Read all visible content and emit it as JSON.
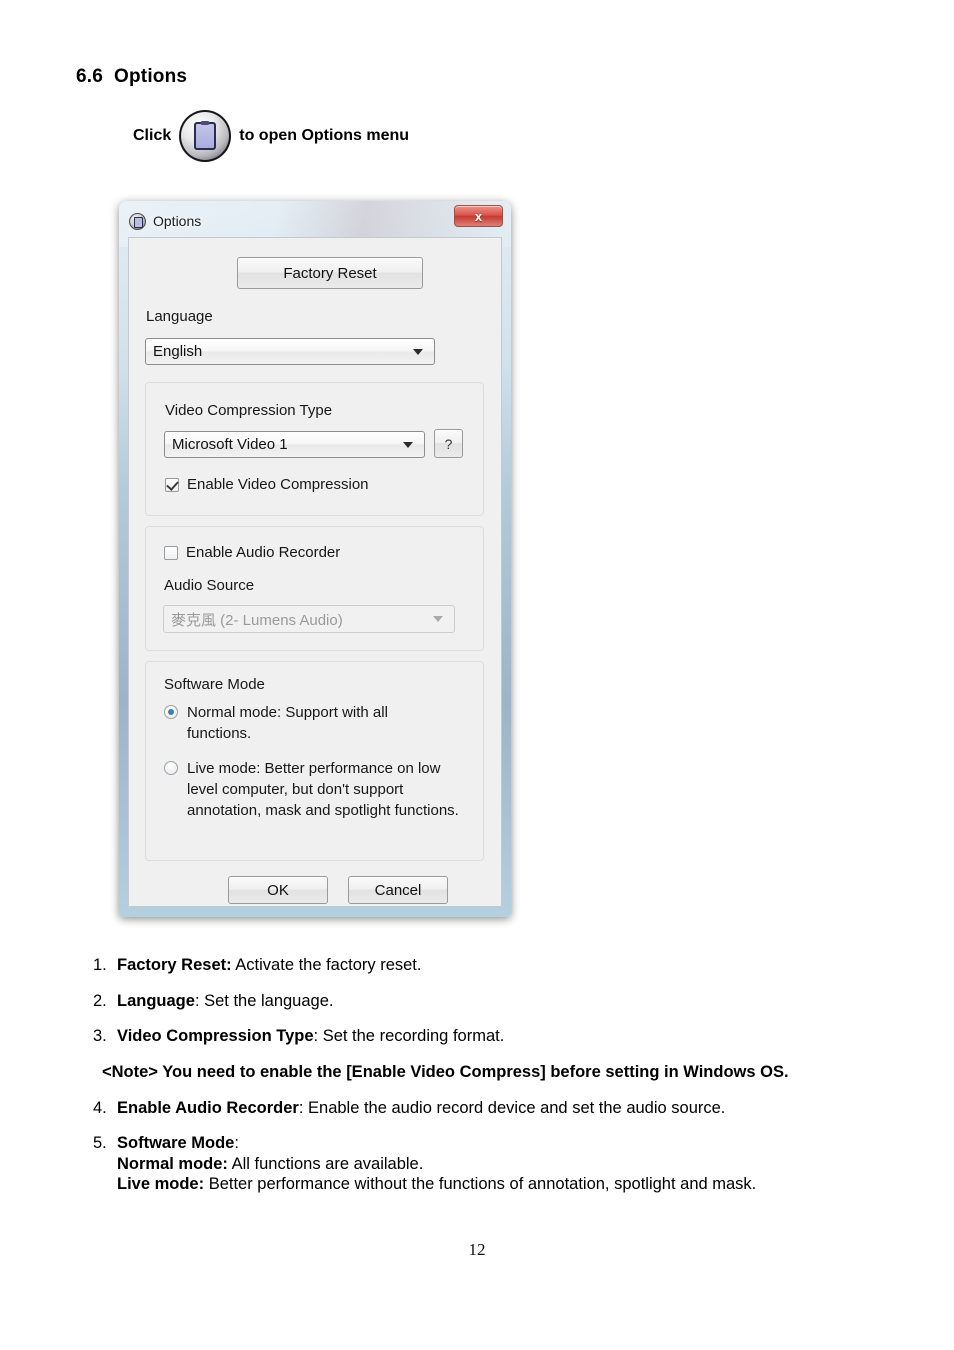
{
  "document": {
    "section_number": "6.6",
    "section_title": "Options",
    "click_prefix": "Click",
    "click_suffix": "to open Options menu",
    "page_number": "12"
  },
  "dialog": {
    "title": "Options",
    "title_icon": "options-window-icon",
    "close_label": "x",
    "factory_reset_label": "Factory Reset",
    "language_label": "Language",
    "language_value": "English",
    "video_group": {
      "type_label": "Video Compression Type",
      "type_value": "Microsoft Video 1",
      "help_label": "?",
      "enable_label": "Enable Video Compression",
      "enable_checked": true
    },
    "audio_group": {
      "enable_label": "Enable Audio Recorder",
      "enable_checked": false,
      "source_label": "Audio Source",
      "source_value": "麥克風 (2- Lumens Audio)",
      "source_disabled": true
    },
    "mode_group": {
      "group_label": "Software Mode",
      "normal_label": "Normal mode: Support with all functions.",
      "normal_selected": true,
      "live_label": "Live mode: Better performance on low level computer, but don't support annotation, mask and spotlight functions.",
      "live_selected": false
    },
    "ok_label": "OK",
    "cancel_label": "Cancel"
  },
  "description": {
    "items": [
      {
        "num": "1.",
        "term": "Factory Reset:",
        "text": " Activate the factory reset."
      },
      {
        "num": "2.",
        "term": "Language",
        "text": ": Set the language."
      },
      {
        "num": "3.",
        "term": "Video Compression Type",
        "text": ": Set the recording format."
      }
    ],
    "note": "<Note> You need to enable the [Enable Video Compress] before setting in Windows OS.",
    "item4": {
      "num": "4.",
      "term": "Enable Audio Recorder",
      "text": ": Enable the audio record device and set the audio source."
    },
    "item5": {
      "num": "5.",
      "term": "Software Mode",
      "text": ":"
    },
    "item5_normal_term": "Normal mode:",
    "item5_normal_text": " All functions are available.",
    "item5_live_term": "Live mode:",
    "item5_live_text": " Better performance without the functions of annotation, spotlight and mask."
  },
  "colors": {
    "close_red": "#d9544a",
    "radio_blue": "#3c7fb1",
    "dialog_bg": "#f0f0f0",
    "icon_purple": "#a8adde"
  }
}
